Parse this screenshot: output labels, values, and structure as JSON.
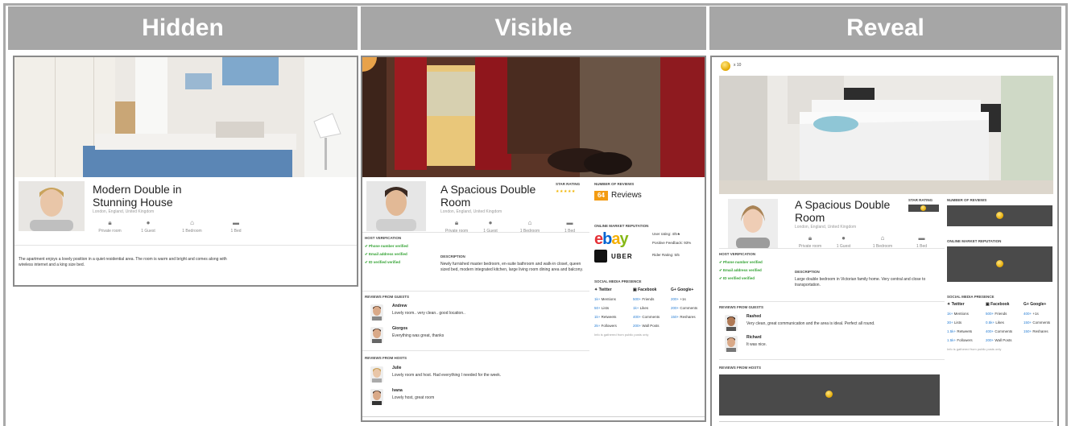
{
  "headers": {
    "hidden": "Hidden",
    "visible": "Visible",
    "reveal": "Reveal"
  },
  "hidden": {
    "title_line1": "Modern Double in",
    "title_line2": "Stunning House",
    "location": "London, England, United Kingdom",
    "amenities": [
      "Private room",
      "1 Guest",
      "1 Bedroom",
      "1 Bed"
    ],
    "description": "The apartment enjoys a lovely position in a quiet residential area. The room is warm and bright and comes along with wireless internet and a king size bed."
  },
  "visible": {
    "title_line1": "A Spacious Double",
    "title_line2": "Room",
    "location": "London, England, United Kingdom",
    "amenities": [
      "Private room",
      "1 Guest",
      "1 Bedroom",
      "1 Bed"
    ],
    "star_rating_label": "STAR RATING",
    "stars": "★★★★★",
    "number_of_reviews_label": "NUMBER OF REVIEWS",
    "review_count": "64",
    "reviews_word": "Reviews",
    "host_verification_label": "HOST VERIFICATION",
    "verifications": [
      "✔ Phone number verified",
      "✔ Email address verified",
      "✔ ID verified verified"
    ],
    "description_label": "DESCRIPTION",
    "description": "Newly furnished master bedroom, en-suite bathroom and walk-in closet, queen sized bed, modern integrated kitchen, large living room dining area and balcony.",
    "reputation_label": "ONLINE MARKET REPUTATION",
    "ebay_logo": "ebay",
    "ebay_rating": "User rating: 4/5★",
    "ebay_feedback": "Positive Feedback: 93%",
    "uber_logo": "UBER",
    "uber_rating": "Rider Rating: 5/5",
    "social_label": "SOCIAL MEDIA PRESENCE",
    "social": {
      "twitter": {
        "name": "Twitter",
        "rows": [
          [
            "1k+",
            "Mentions"
          ],
          [
            "50+",
            "Lists"
          ],
          [
            "1k+",
            "Retweets"
          ],
          [
            "2k+",
            "Followers"
          ]
        ]
      },
      "facebook": {
        "name": "Facebook",
        "rows": [
          [
            "500+",
            "Friends"
          ],
          [
            "1k+",
            "Likes"
          ],
          [
            "400+",
            "Comments"
          ],
          [
            "200+",
            "Wall Posts"
          ]
        ]
      },
      "google": {
        "name": "Google+",
        "rows": [
          [
            "200+",
            "+1s"
          ],
          [
            "200+",
            "Comments"
          ],
          [
            "150+",
            "Reshares"
          ]
        ]
      }
    },
    "social_note": "Info is gathered from public posts only",
    "guest_reviews_label": "REVIEWS FROM GUESTS",
    "guest_reviews": [
      {
        "name": "Andrew",
        "text": "Lovely room.. very clean.. good location.."
      },
      {
        "name": "Giorgos",
        "text": "Everything was great, thanks"
      }
    ],
    "host_reviews_label": "REVIEWS FROM HOSTS",
    "host_reviews": [
      {
        "name": "Julie",
        "text": "Lovely room and host. Had everything I needed for the week."
      },
      {
        "name": "Ivana",
        "text": "Lovely host, great room"
      }
    ]
  },
  "reveal": {
    "coin_count": "x 10",
    "title_line1": "A Spacious Double",
    "title_line2": "Room",
    "location": "London, England, United Kingdom",
    "amenities": [
      "Private room",
      "1 Guest",
      "1 Bedroom",
      "1 Bed"
    ],
    "star_rating_label": "STAR RATING",
    "number_of_reviews_label": "NUMBER OF REVIEWS",
    "host_verification_label": "HOST VERIFICATION",
    "verifications": [
      "✔ Phone number verified",
      "✔ Email address verified",
      "✔ ID verified verified"
    ],
    "description_label": "DESCRIPTION",
    "description": "Large double bedroom in Victorian family home. Very central and close to transportation.",
    "reputation_label": "ONLINE MARKET REPUTATION",
    "social_label": "SOCIAL MEDIA PRESENCE",
    "social": {
      "twitter": {
        "name": "Twitter",
        "rows": [
          [
            "1k+",
            "Mentions"
          ],
          [
            "30+",
            "Lists"
          ],
          [
            "1.5k+",
            "Retweets"
          ],
          [
            "1.5k+",
            "Followers"
          ]
        ]
      },
      "facebook": {
        "name": "Facebook",
        "rows": [
          [
            "500+",
            "Friends"
          ],
          [
            "0.5k+",
            "Likes"
          ],
          [
            "400+",
            "Comments"
          ],
          [
            "200+",
            "Wall Posts"
          ]
        ]
      },
      "google": {
        "name": "Google+",
        "rows": [
          [
            "400+",
            "+1s"
          ],
          [
            "150+",
            "Comments"
          ],
          [
            "150+",
            "Reshares"
          ]
        ]
      }
    },
    "social_note": "Info is gathered from public posts only",
    "guest_reviews_label": "REVIEWS FROM GUESTS",
    "guest_reviews": [
      {
        "name": "Rashed",
        "text": "Very clean, great communication and the area is ideal. Perfect all round."
      },
      {
        "name": "Richard",
        "text": "It was nice."
      }
    ],
    "host_reviews_label": "REVIEWS FROM HOSTS"
  }
}
